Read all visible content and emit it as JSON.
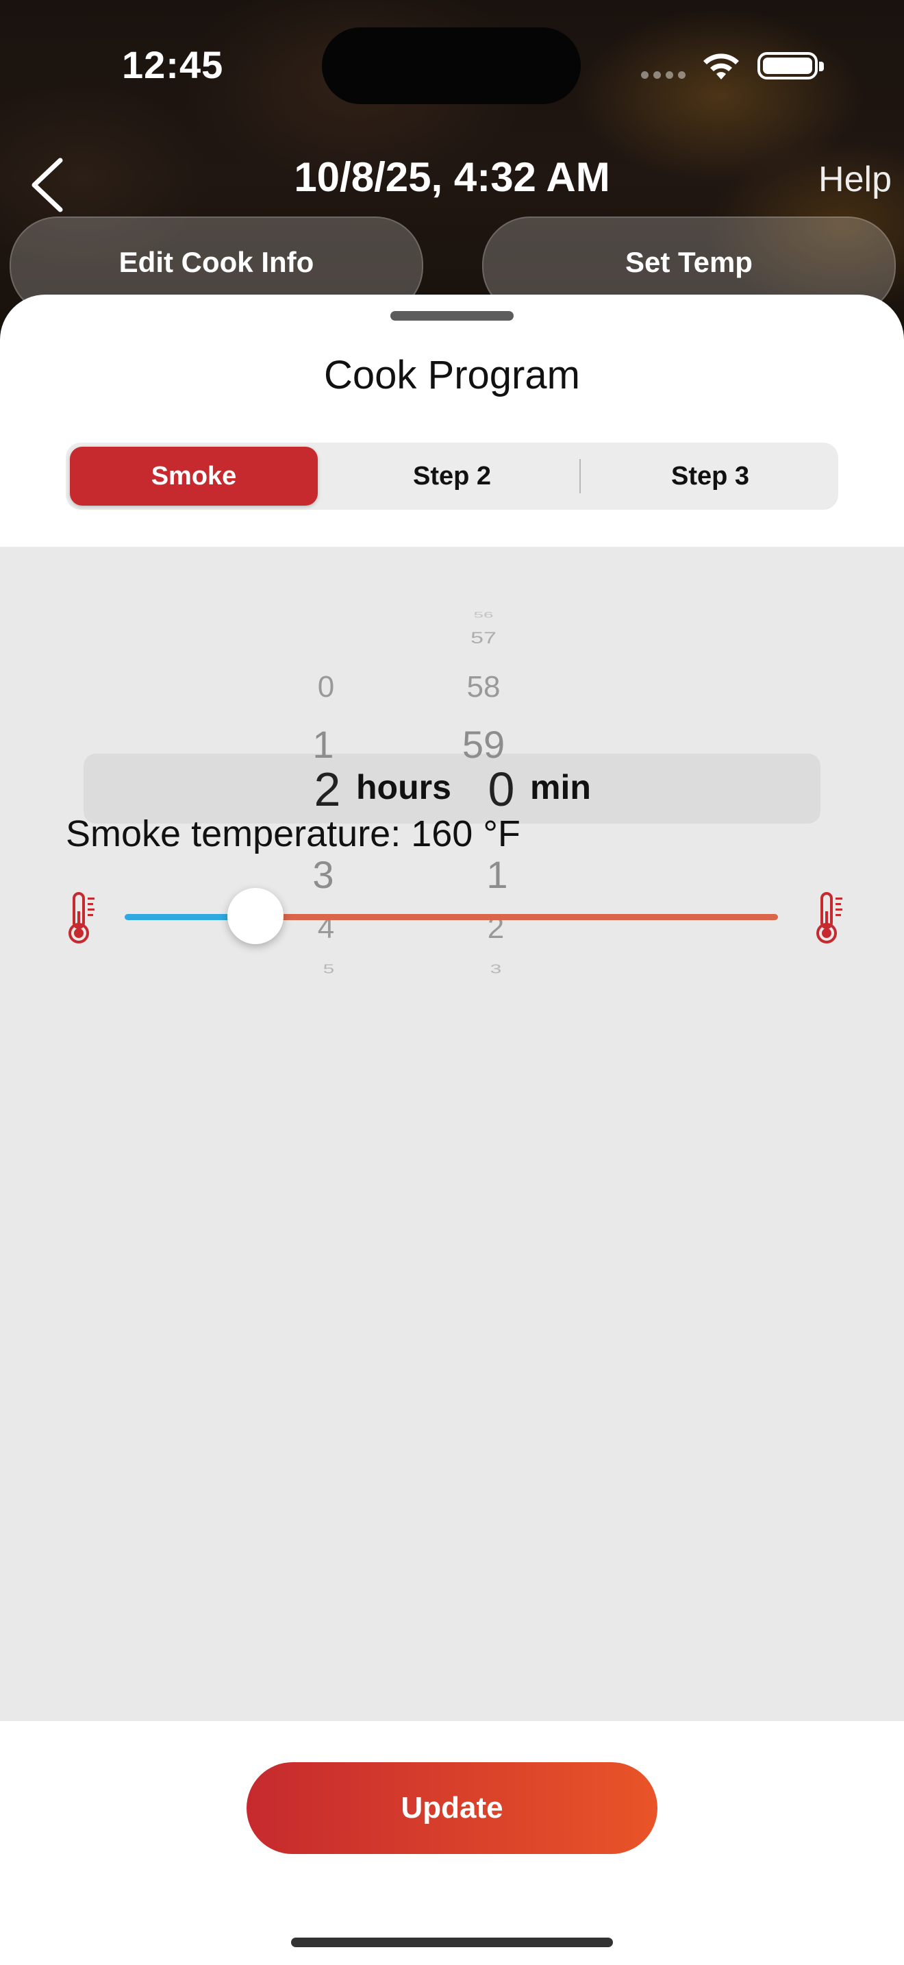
{
  "status_bar": {
    "time": "12:45"
  },
  "nav": {
    "back_icon": "chevron-left-icon",
    "title": "10/8/25, 4:32 AM",
    "help_label": "Help"
  },
  "header_buttons": {
    "edit_cook_info": "Edit Cook Info",
    "set_temp": "Set Temp"
  },
  "sheet": {
    "title": "Cook Program",
    "tabs": [
      {
        "label": "Smoke",
        "active": true
      },
      {
        "label": "Step 2",
        "active": false
      },
      {
        "label": "Step 3",
        "active": false
      }
    ]
  },
  "duration_picker": {
    "hours_unit": "hours",
    "minutes_unit": "min",
    "selected_hours": "2",
    "selected_minutes": "0",
    "hours_above": [
      "0",
      "1"
    ],
    "hours_below": [
      "3",
      "4",
      "5"
    ],
    "minutes_above": [
      "56",
      "57",
      "58",
      "59"
    ],
    "minutes_below": [
      "1",
      "2",
      "3"
    ]
  },
  "temperature": {
    "label": "Smoke temperature: 160 °F",
    "slider_fraction": 0.2,
    "low_color": "#2fa9e0",
    "high_color": "#d9654a",
    "icon_color": "#c62a2e",
    "left_icon": "thermometer-icon",
    "right_icon": "thermometer-icon"
  },
  "update_button": {
    "label": "Update"
  }
}
